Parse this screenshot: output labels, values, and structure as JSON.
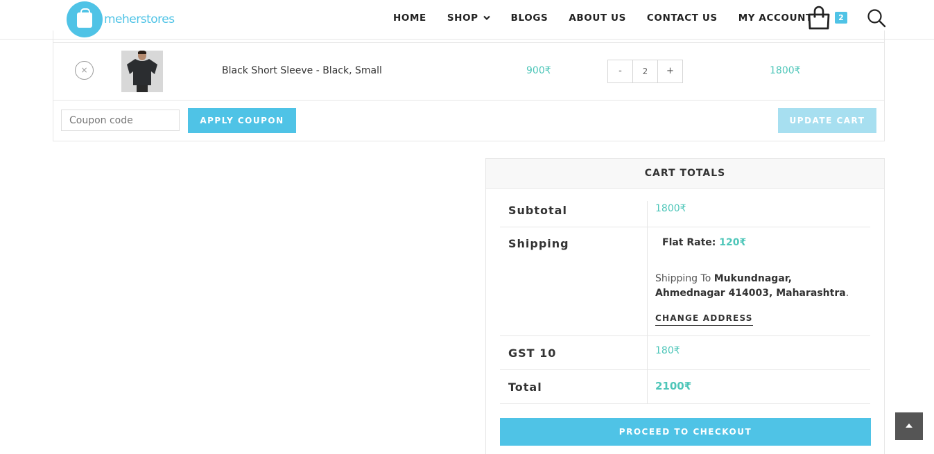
{
  "brand": {
    "name": "meherstores",
    "accent": "#4fc3e6",
    "price_color": "#4ec6b9"
  },
  "nav": {
    "items": [
      "HOME",
      "SHOP",
      "BLOGS",
      "ABOUT US",
      "CONTACT US",
      "MY ACCOUNT"
    ],
    "shop_chevron": "chevron-down-icon"
  },
  "header": {
    "cart_count": "2",
    "cart_icon": "shopping-bag-icon",
    "search_icon": "search-icon"
  },
  "cart": {
    "items": [
      {
        "name": "Black Short Sleeve - Black, Small",
        "price": "900₹",
        "quantity": "2",
        "subtotal": "1800₹",
        "remove_symbol": "×",
        "qty_minus": "-",
        "qty_plus": "+"
      }
    ],
    "coupon_placeholder": "Coupon code",
    "apply_coupon_label": "APPLY COUPON",
    "update_cart_label": "UPDATE CART"
  },
  "totals": {
    "heading": "CART TOTALS",
    "subtotal_label": "Subtotal",
    "subtotal_value": "1800₹",
    "shipping_label": "Shipping",
    "flat_rate_label": "Flat Rate:",
    "flat_rate_value": "120₹",
    "shipping_to_prefix": "Shipping To",
    "shipping_address": "Mukundnagar, Ahmednagar 414003, Maharashtra",
    "change_address_label": "CHANGE ADDRESS",
    "gst_label": "GST 10",
    "gst_value": "180₹",
    "total_label": "Total",
    "total_value": "2100₹",
    "checkout_label": "PROCEED TO CHECKOUT"
  },
  "scroll_top_icon": "arrow-up-icon"
}
